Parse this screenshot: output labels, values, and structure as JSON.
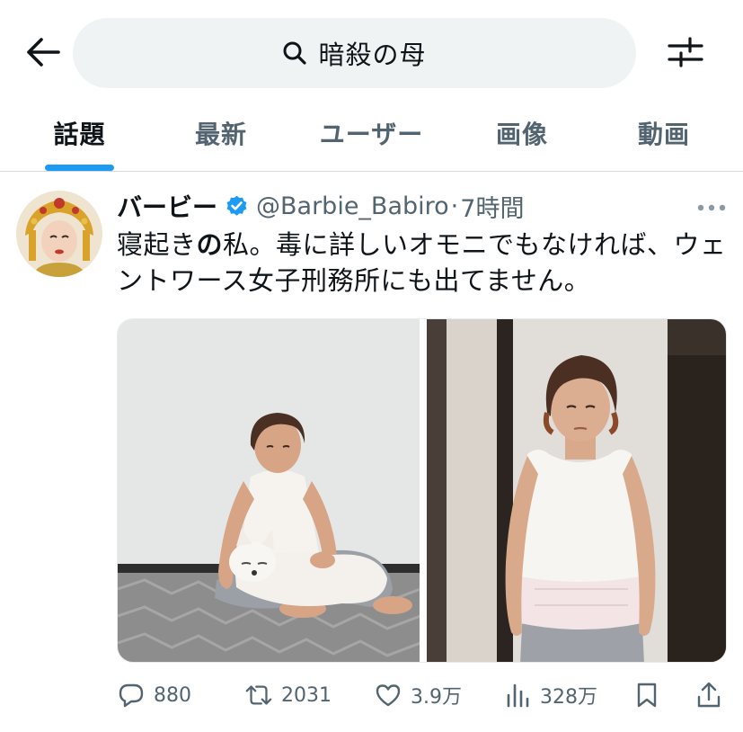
{
  "search": {
    "query": "暗殺の母"
  },
  "tabs": [
    {
      "label": "話題",
      "active": true
    },
    {
      "label": "最新",
      "active": false
    },
    {
      "label": "ユーザー",
      "active": false
    },
    {
      "label": "画像",
      "active": false
    },
    {
      "label": "動画",
      "active": false
    }
  ],
  "tweet": {
    "display_name": "バービー",
    "handle": "@Barbie_Babiro",
    "separator": "·",
    "time": "7時間",
    "text_part1": "寝起き",
    "text_bold": "の",
    "text_part2": "私。毒に詳しいオモニでもなければ、ウェントワース女子刑務所にも出てません。",
    "stats": {
      "replies": "880",
      "retweets": "2031",
      "likes": "3.9万",
      "views": "328万"
    }
  },
  "colors": {
    "accent": "#1d9bf0",
    "secondary_text": "#536471",
    "search_bg": "#eff3f4"
  },
  "icons": {
    "back": "arrow-left-icon",
    "search": "search-icon",
    "filter": "sliders-icon",
    "verified": "verified-badge-icon",
    "more": "more-horizontal-icon",
    "reply": "reply-icon",
    "retweet": "retweet-icon",
    "like": "heart-icon",
    "views": "views-icon",
    "bookmark": "bookmark-icon",
    "share": "share-icon"
  }
}
